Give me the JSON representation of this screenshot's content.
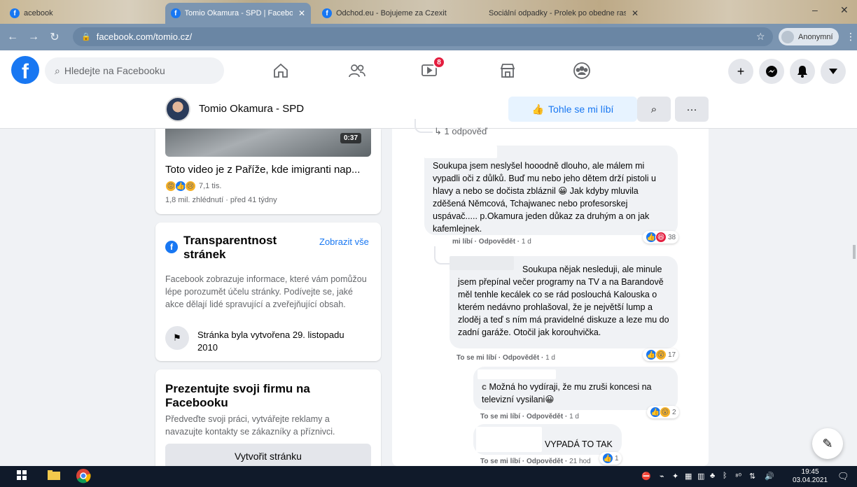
{
  "browser": {
    "tabs": [
      {
        "label": "acebook"
      },
      {
        "label": "Tomio Okamura - SPD | Faceboo"
      },
      {
        "label": "Odchod.eu - Bojujeme za Czexit"
      },
      {
        "label": "Sociální odpadky - Prolek po obedne ras"
      }
    ],
    "url": "facebook.com/tomio.cz/",
    "profile_label": "Anonymní"
  },
  "fb": {
    "search_placeholder": "Hledejte na Facebooku",
    "notifications_badge": "8"
  },
  "page_header": {
    "name": "Tomio Okamura - SPD",
    "like_label": "Tohle se mi líbí"
  },
  "video": {
    "duration": "0:37",
    "title": "Toto video je z Paříže, kde imigranti nap...",
    "reaction_count": "7,1 tis.",
    "meta": "1,8 mil. zhlédnutí · před 41 týdny"
  },
  "transparency": {
    "title": "Transparentnost stránek",
    "link": "Zobrazit vše",
    "text": "Facebook zobrazuje informace, které vám pomůžou lépe porozumět účelu stránky. Podívejte se, jaké akce dělají lidé spravující a zveřejňující obsah.",
    "created": "Stránka byla vytvořena 29. listopadu 2010"
  },
  "promo": {
    "title": "Prezentujte svoji firmu na Facebooku",
    "text": "Předveďte svoji práci, vytvářejte reklamy a navazujte kontakty se zákazníky a příznivci.",
    "button": "Vytvořit stránku"
  },
  "comments": {
    "reply_link": "1 odpověď",
    "items": [
      {
        "text": "Soukupa jsem neslyšel hooodně dlouho, ale málem mi vypadli oči z důlků. Buď mu nebo jeho dětem drží pistoli u hlavy a nebo se dočista zbláznil 😀 Jak kdyby mluvila zděšená Němcová, Tchajwanec nebo profesorskej uspávač..... p.Okamura jeden důkaz za druhým a on jak kafemlejnek.",
        "like": "mi líbí",
        "reply": "Odpovědět",
        "time": "1 d",
        "count": "38"
      },
      {
        "text": "Soukupa nějak nesleduji, ale minule jsem přepínal večer programy na TV a na Barandově měl tenhle kecálek co se rád poslouchá Kalouska o kterém nedávno prohlašoval, že je největší lump a zloděj a teď s ním má pravidelné diskuze a leze mu do zadní garáže. Otočil jak korouhvička.",
        "like": "To se mi líbí",
        "reply": "Odpovědět",
        "time": "1 d",
        "count": "17"
      },
      {
        "author_tail": "c",
        "text": "Možná ho vydíraji, že mu zruši koncesi na televizní vysilani😀",
        "like": "To se mi líbí",
        "reply": "Odpovědět",
        "time": "1 d",
        "count": "2"
      },
      {
        "text": "VYPADÁ TO TAK",
        "like": "To se mi líbí",
        "reply": "Odpovědět",
        "time": "21 hod",
        "count": "1"
      }
    ]
  },
  "taskbar": {
    "time": "19:45",
    "date": "03.04.2021"
  }
}
